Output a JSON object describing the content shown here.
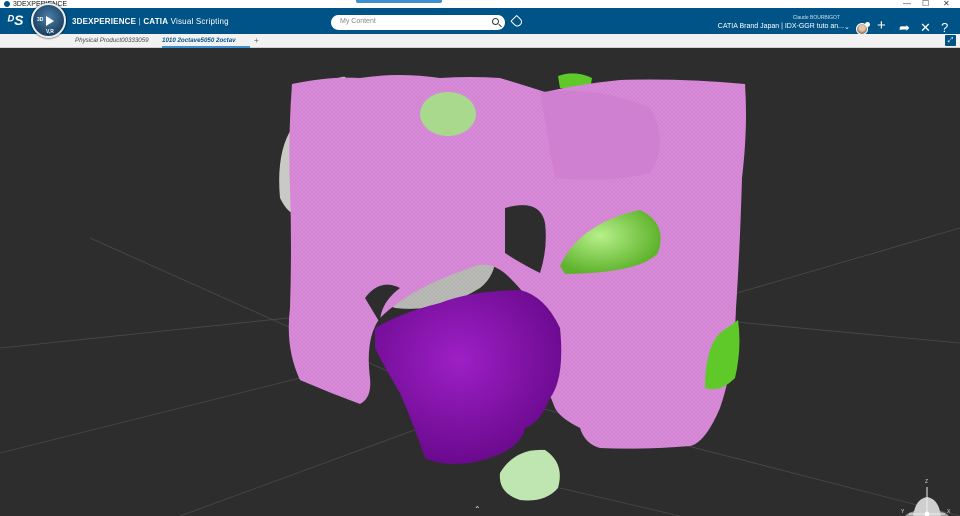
{
  "window": {
    "title": "3DEXPERIENCE",
    "controls": [
      "—",
      "☐",
      "✕"
    ]
  },
  "topbar": {
    "brand_main": "3DEXPERIENCE",
    "brand_sep": " | ",
    "brand_catia": "CATIA",
    "brand_app": " Visual Scripting",
    "compass_top": "3D",
    "compass_bottom": "V,R",
    "search_placeholder": "My Content",
    "user_name": "Claude BOURBIGOT",
    "context": "CATIA Brand Japan | IDX-GGR tuto an...",
    "icons": [
      "search-icon",
      "tag-icon",
      "plus-icon",
      "share-icon",
      "tools-icon",
      "help-icon"
    ]
  },
  "tabs": [
    {
      "label": "Physical Product00333059",
      "active": false
    },
    {
      "label": "1010 2octave5050 2octav",
      "active": true
    }
  ],
  "tab_add": "+",
  "viewport": {
    "axis_labels": {
      "z": "Z",
      "x": "X",
      "y": "Y"
    },
    "colors": {
      "background": "#2d2d2d",
      "main_body": "#d889d8",
      "selected_body": "#8a10b2",
      "green_part": "#7bd640",
      "light_green": "#a8d98c",
      "grey_part": "#c9c9c6"
    }
  }
}
